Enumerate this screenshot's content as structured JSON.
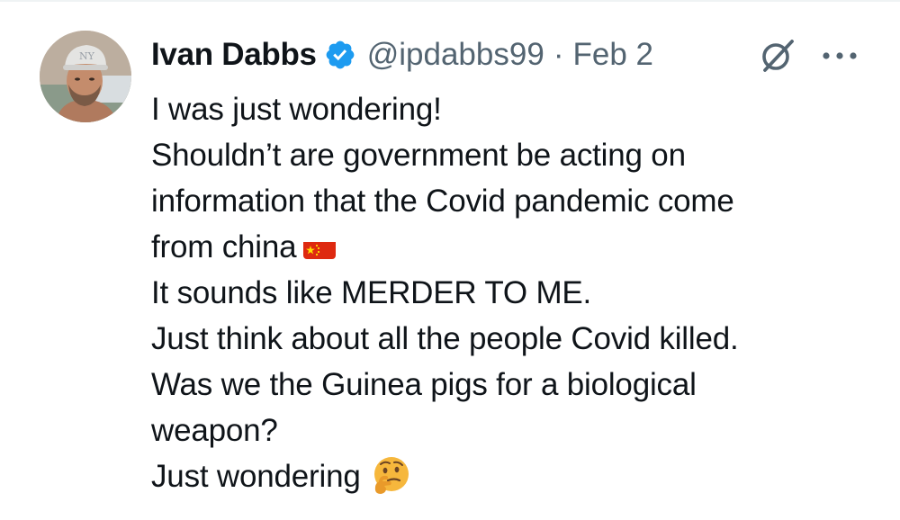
{
  "tweet": {
    "display_name": "Ivan Dabbs",
    "handle": "@ipdabbs99",
    "separator": "·",
    "date": "Feb 2",
    "verified": true,
    "icons": {
      "verified": "verified-badge-icon",
      "grok": "grok-icon",
      "more": "more-options-icon",
      "flag": "china-flag-emoji",
      "emoji": "thinking-face-emoji"
    },
    "colors": {
      "verified_blue": "#1d9bf0",
      "text": "#0f1419",
      "secondary": "#536471"
    },
    "lines": [
      "I was just wondering!",
      "Shouldn’t are government be acting on",
      "information that the Covid pandemic come",
      "from china",
      "It sounds like MERDER TO ME.",
      "Just think about all the people Covid killed.",
      "Was we the Guinea pigs for a biological",
      "weapon?",
      "Just wondering"
    ]
  }
}
